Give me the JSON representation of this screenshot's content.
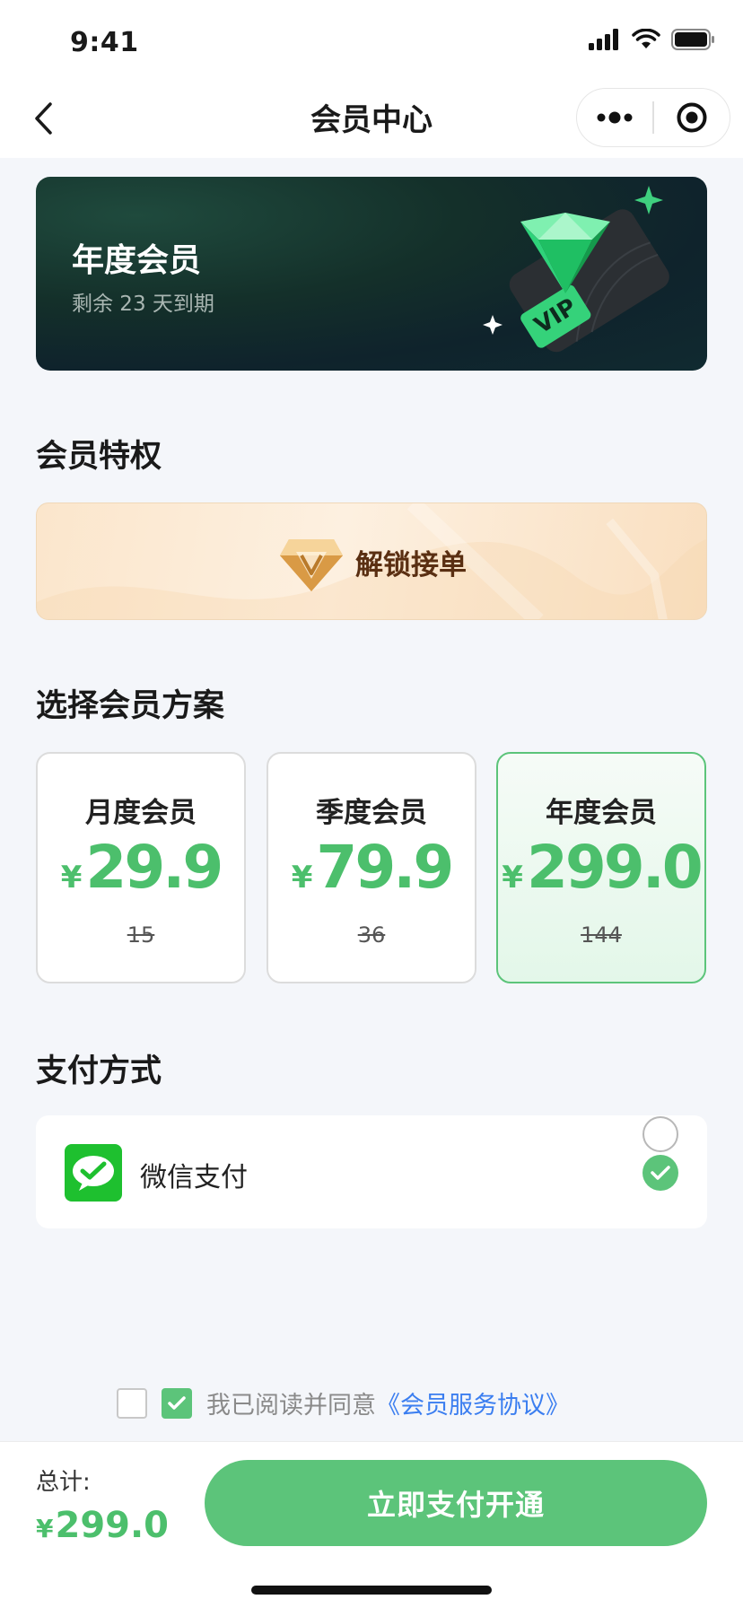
{
  "status_bar": {
    "time": "9:41"
  },
  "nav": {
    "title": "会员中心",
    "back_icon": "chevron-left-icon",
    "more_icon": "more-dots-icon",
    "close_icon": "target-circle-icon"
  },
  "vip_card": {
    "title": "年度会员",
    "subtitle": "剩余 23 天到期",
    "badge_text": "VIP"
  },
  "privileges": {
    "section_title": "会员特权",
    "item_label": "解锁接单"
  },
  "plans": {
    "section_title": "选择会员方案",
    "currency": "¥",
    "items": [
      {
        "name": "月度会员",
        "price": "29.9",
        "original": "15",
        "selected": false
      },
      {
        "name": "季度会员",
        "price": "79.9",
        "original": "36",
        "selected": false
      },
      {
        "name": "年度会员",
        "price": "299.0",
        "original": "144",
        "selected": true
      }
    ]
  },
  "payment": {
    "section_title": "支付方式",
    "method_label": "微信支付"
  },
  "agreement": {
    "text": "我已阅读并同意",
    "link": "《会员服务协议》"
  },
  "footer": {
    "total_label": "总计:",
    "currency": "¥",
    "total_amount": "299.0",
    "pay_button": "立即支付开通"
  },
  "colors": {
    "accent": "#5cc47a",
    "price": "#4cbf6c",
    "link": "#3b7ef0",
    "wechat": "#1ec02f"
  }
}
